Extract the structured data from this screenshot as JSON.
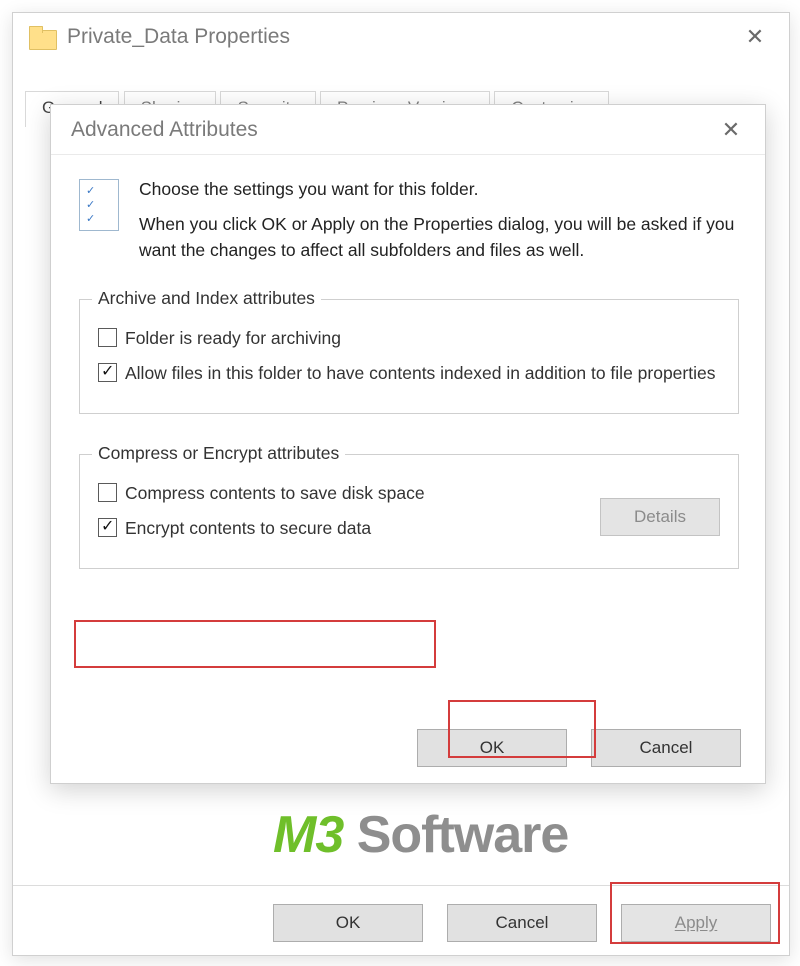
{
  "properties": {
    "title": "Private_Data Properties",
    "tabs": {
      "general": "General",
      "sharing": "Sharing",
      "security": "Security",
      "previous": "Previous Versions",
      "customize": "Customize"
    },
    "buttons": {
      "ok": "OK",
      "cancel": "Cancel",
      "apply": "Apply"
    }
  },
  "advanced": {
    "title": "Advanced Attributes",
    "choose_text": "Choose the settings you want for this folder.",
    "explain_text": "When you click OK or Apply on the Properties dialog, you will be asked if you want the changes to affect all subfolders and files as well.",
    "group_archive": {
      "legend": "Archive and Index attributes",
      "ready_label": "Folder is ready for archiving",
      "ready_checked": false,
      "index_label": "Allow files in this folder to have contents indexed in addition to file properties",
      "index_checked": true
    },
    "group_encrypt": {
      "legend": "Compress or Encrypt attributes",
      "compress_label": "Compress contents to save disk space",
      "compress_checked": false,
      "encrypt_label": "Encrypt contents to secure data",
      "encrypt_checked": true,
      "details": "Details"
    },
    "buttons": {
      "ok": "OK",
      "cancel": "Cancel"
    }
  },
  "watermark": {
    "m3": "M3",
    "software": " Software"
  }
}
